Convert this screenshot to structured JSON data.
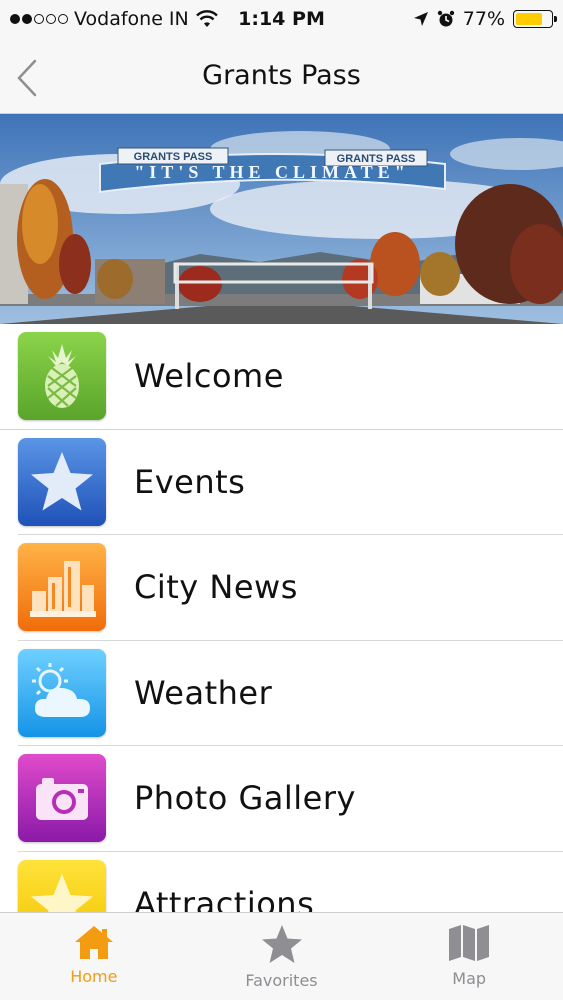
{
  "status_bar": {
    "carrier": "Vodafone IN",
    "time": "1:14 PM",
    "battery_percent": "77%",
    "battery_level": 0.77,
    "signal_bars_filled": 2,
    "signal_bars_total": 5
  },
  "nav": {
    "title": "Grants Pass",
    "back_icon": "chevron-left-icon"
  },
  "banner": {
    "sign_text": "\"IT'S THE CLIMATE\"",
    "sign_left": "GRANTS PASS",
    "sign_right": "GRANTS PASS"
  },
  "menu": [
    {
      "label": "Welcome",
      "icon": "pineapple-icon",
      "color": "#6cbf3a"
    },
    {
      "label": "Events",
      "icon": "star-icon",
      "color": "#2f66cc"
    },
    {
      "label": "City News",
      "icon": "buildings-icon",
      "color": "#f5871f"
    },
    {
      "label": "Weather",
      "icon": "sun-cloud-icon",
      "color": "#2aa7ef"
    },
    {
      "label": "Photo Gallery",
      "icon": "camera-icon",
      "color": "#b52fb8"
    },
    {
      "label": "Attractions",
      "icon": "star-icon",
      "color": "#f7d515"
    }
  ],
  "tabs": [
    {
      "label": "Home",
      "icon": "home-icon",
      "active": true
    },
    {
      "label": "Favorites",
      "icon": "star-icon",
      "active": false
    },
    {
      "label": "Map",
      "icon": "map-icon",
      "active": false
    }
  ],
  "colors": {
    "accent": "#f39c12",
    "inactive_tab": "#8e8e93"
  }
}
